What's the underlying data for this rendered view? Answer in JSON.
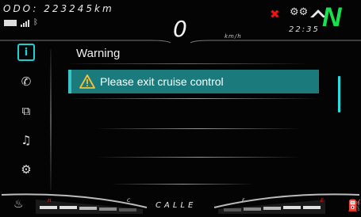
{
  "header": {
    "odometer": "ODO: 223245km",
    "speed": "0",
    "speed_unit": "km/h",
    "clock": "22:35",
    "gear": "N"
  },
  "status_icons": [
    "battery-icon",
    "signal-icon",
    "bluetooth-icon",
    "fault-warning-icon",
    "engine-icon",
    "navigation-chevron-icon"
  ],
  "sidebar": {
    "items": [
      {
        "name": "info",
        "glyph": "i",
        "active": true
      },
      {
        "name": "phone",
        "glyph": "✆",
        "active": false
      },
      {
        "name": "connect",
        "glyph": "⧉",
        "active": false
      },
      {
        "name": "music",
        "glyph": "♫",
        "active": false
      },
      {
        "name": "settings",
        "glyph": "⚙",
        "active": false
      }
    ]
  },
  "main": {
    "title": "Warning",
    "warnings": [
      {
        "text": "Please exit cruise control"
      }
    ]
  },
  "bottom": {
    "street": "CALLE",
    "temp_cold_label": "C",
    "temp_hot_label": "H",
    "fuel_empty_label": "E",
    "fuel_full_label": "F"
  },
  "colors": {
    "accent": "#1fd0d2",
    "warning_row": "#1b7b7c",
    "gear": "#18e14d",
    "alert": "#e11111"
  }
}
